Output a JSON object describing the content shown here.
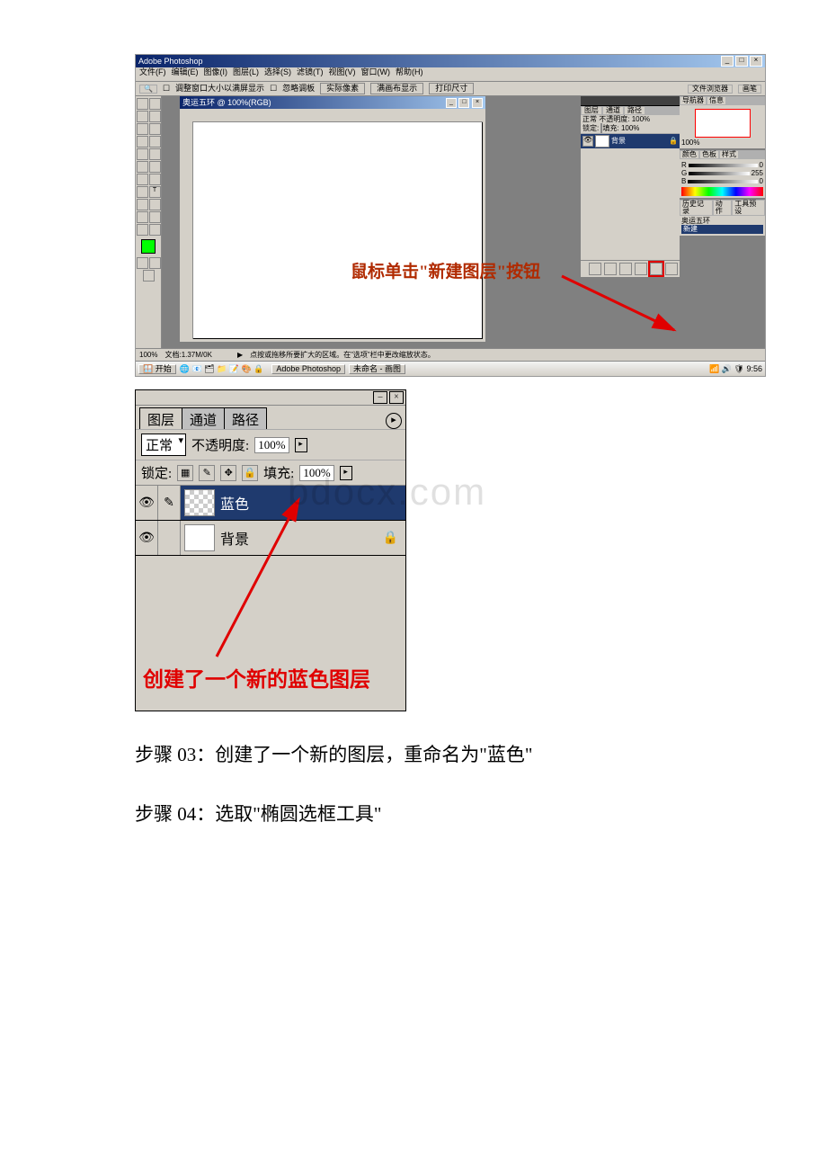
{
  "screenshot1": {
    "app_title": "Adobe Photoshop",
    "window_controls": {
      "min": "_",
      "max": "□",
      "close": "×"
    },
    "menus": [
      "文件(F)",
      "编辑(E)",
      "图像(I)",
      "图层(L)",
      "选择(S)",
      "滤镜(T)",
      "视图(V)",
      "窗口(W)",
      "帮助(H)"
    ],
    "options": {
      "opt_resize": "调整窗口大小以满屏显示",
      "opt_ignore": "忽略调板",
      "btn_actual": "实际像素",
      "btn_fit": "满画布显示",
      "btn_print": "打印尺寸",
      "file_browser": "文件浏览器",
      "brushes": "画笔"
    },
    "doc_title": "奥运五环 @ 100%(RGB)",
    "doc_zoom": "100",
    "layers_panel": {
      "tabs": [
        "图层",
        "通道",
        "路径"
      ],
      "blend_mode": "正常",
      "opacity_label": "不透明度:",
      "opacity_value": "100%",
      "lock_label": "锁定:",
      "fill_label": "填充:",
      "fill_value": "100%",
      "layer_bg": "背景"
    },
    "navigator": {
      "tabs": [
        "导航器",
        "信息"
      ],
      "zoom": "100%"
    },
    "color_panel": {
      "tabs": [
        "颜色",
        "色板",
        "样式"
      ],
      "r_label": "R",
      "r_val": "0",
      "g_label": "G",
      "g_val": "255",
      "b_label": "B",
      "b_val": "0"
    },
    "history_panel": {
      "tabs": [
        "历史记录",
        "动作",
        "工具预设"
      ],
      "item1": "奥运五环",
      "item2": "新建"
    },
    "statusbar": {
      "zoom": "100%",
      "docinfo": "文档:1.37M/0K",
      "hint": "点按或拖移所要扩大的区域。在\"选项\"栏中更改缩放状态。"
    },
    "taskbar": {
      "start": "开始",
      "app1": "Adobe Photoshop",
      "app2": "未命名 - 画图",
      "clock": "9:56"
    },
    "annotation": "鼠标单击\"新建图层\"按钮"
  },
  "screenshot2": {
    "window_controls": {
      "min": "–",
      "close": "×"
    },
    "tabs": {
      "layers": "图层",
      "channels": "通道",
      "paths": "路径"
    },
    "blend_mode": "正常",
    "opacity_label": "不透明度:",
    "opacity_value": "100%",
    "lock_label": "锁定:",
    "fill_label": "填充:",
    "fill_value": "100%",
    "layer_blue": "蓝色",
    "layer_bg": "背景",
    "annotation": "创建了一个新的蓝色图层",
    "watermark": "bdocx.com"
  },
  "steps": {
    "step03": "步骤 03：创建了一个新的图层，重命名为\"蓝色\"",
    "step04": "步骤 04：选取\"椭圆选框工具\""
  }
}
